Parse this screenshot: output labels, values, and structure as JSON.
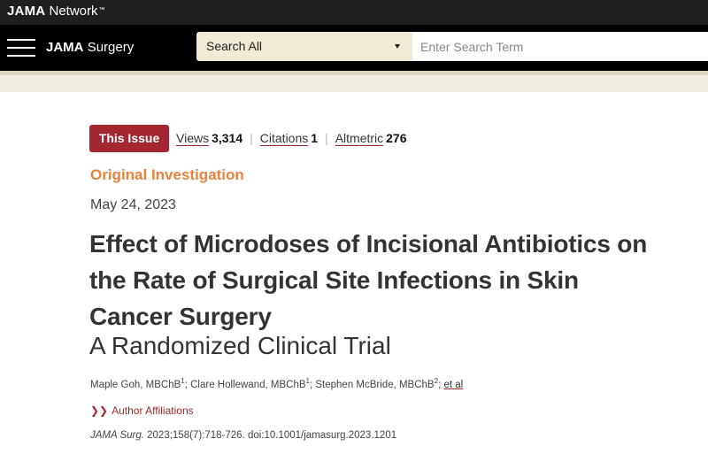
{
  "network": {
    "brand": "JAMA",
    "sub": "Network",
    "tm": "™"
  },
  "journal": {
    "brand": "JAMA",
    "sub": "Surgery"
  },
  "search": {
    "select_label": "Search All",
    "placeholder": "Enter Search Term"
  },
  "article": {
    "issue_badge": "This Issue",
    "metrics": [
      {
        "label": "Views",
        "value": "3,314"
      },
      {
        "label": "Citations",
        "value": "1"
      },
      {
        "label": "Altmetric",
        "value": "276"
      }
    ],
    "separator": "|",
    "category": "Original Investigation",
    "date": "May 24, 2023",
    "title": "Effect of Microdoses of Incisional Antibiotics on the Rate of Surgical Site Infections in Skin Cancer Surgery",
    "subtitle": "A Randomized Clinical Trial",
    "authors": [
      {
        "name": "Maple Goh, MBChB",
        "sup": "1"
      },
      {
        "name": "Clare Hollewand, MBChB",
        "sup": "1"
      },
      {
        "name": "Stephen McBride, MBChB",
        "sup": "2"
      }
    ],
    "author_sep": ";",
    "etal": "et al",
    "affiliations_chevron": "❯❯",
    "affiliations": "Author Affiliations",
    "citation_journal": "JAMA Surg.",
    "citation_rest": "2023;158(7):718-726. doi:10.1001/jamasurg.2023.1201"
  },
  "colors": {
    "accent": "#a32731",
    "category": "#e8823d",
    "search_select_bg": "#f0ead6",
    "strip": "#f2ede2"
  }
}
